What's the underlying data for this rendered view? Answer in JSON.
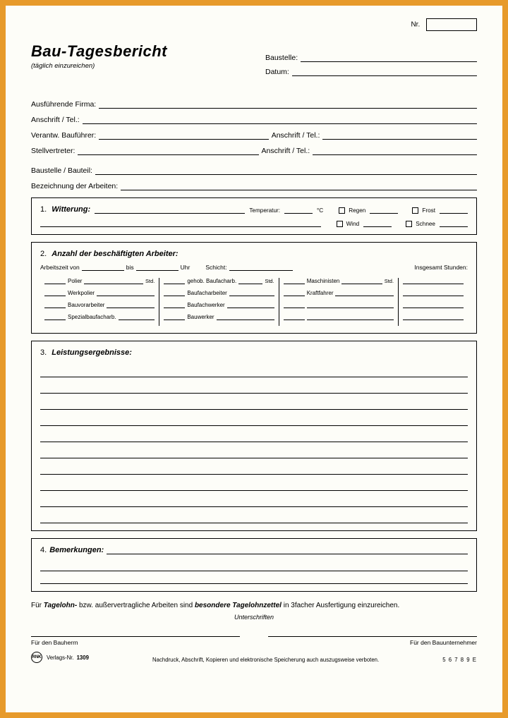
{
  "header": {
    "nr_label": "Nr.",
    "title": "Bau-Tagesbericht",
    "subtitle": "(täglich einzureichen)",
    "baustelle_label": "Baustelle:",
    "datum_label": "Datum:"
  },
  "meta": {
    "firma": "Ausführende Firma:",
    "anschrift": "Anschrift / Tel.:",
    "baufuehrer": "Verantw. Bauführer:",
    "baufuehrer_anschrift": "Anschrift / Tel.:",
    "stellvertreter": "Stellvertreter:",
    "stellvertreter_anschrift": "Anschrift / Tel.:",
    "baustelle_bauteil": "Baustelle / Bauteil:",
    "bezeichnung": "Bezeichnung der Arbeiten:"
  },
  "s1": {
    "num": "1.",
    "title": "Witterung:",
    "temperatur": "Temperatur:",
    "grad": "°C",
    "regen": "Regen",
    "frost": "Frost",
    "wind": "Wind",
    "schnee": "Schnee"
  },
  "s2": {
    "num": "2.",
    "title": "Anzahl der beschäftigten Arbeiter:",
    "arbeitszeit_von": "Arbeitszeit von",
    "bis": "bis",
    "uhr": "Uhr",
    "schicht": "Schicht:",
    "insg": "Insgesamt Stunden:",
    "c1": [
      "Polier",
      "Werkpolier",
      "Bauvorarbeiter",
      "Spezialbaufacharb."
    ],
    "c2": [
      "gehob. Baufacharb.",
      "Baufacharbeiter",
      "Baufachwerker",
      "Bauwerker"
    ],
    "c3": [
      "Maschinisten",
      "Kraftfahrer"
    ],
    "std": "Std."
  },
  "s3": {
    "num": "3.",
    "title": "Leistungsergebnisse:"
  },
  "s4": {
    "num": "4.",
    "title": "Bemerkungen:"
  },
  "footer": {
    "line_a": "Für ",
    "tagelohn": "Tagelohn-",
    "line_b": " bzw. außervertragliche Arbeiten sind ",
    "zettel": "besondere Tagelohnzettel",
    "line_c": " in 3facher Ausfertigung einzureichen.",
    "unterschriften": "Unterschriften",
    "bauherrn": "Für den Bauherrn",
    "bauunternehmer": "Für den Bauunternehmer",
    "verlag_nr_label": "Verlags-Nr.",
    "verlag_nr": "1309",
    "logo": "RNK",
    "copyright": "Nachdruck, Abschrift, Kopieren und elektronische Speicherung auch auszugsweise verboten.",
    "form_code": "5 6 7 8 9  E"
  }
}
